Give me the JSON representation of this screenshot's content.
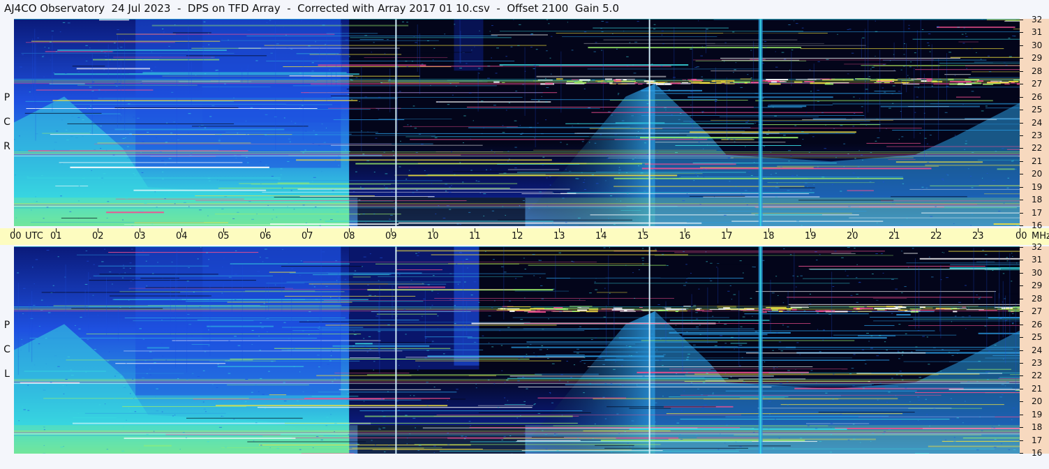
{
  "header": {
    "title": "AJ4CO Observatory  24 Jul 2023  -  DPS on TFD Array  -  Corrected with Array 2017 01 10.csv  -  Offset 2100  Gain 5.0"
  },
  "panels": [
    {
      "polarization": "RCP",
      "letters": [
        "R",
        "C",
        "P"
      ]
    },
    {
      "polarization": "LCP",
      "letters": [
        "L",
        "C",
        "P"
      ]
    }
  ],
  "chart_data": {
    "type": "heatmap",
    "title": "AJ4CO Observatory  24 Jul 2023  -  DPS on TFD Array  -  Corrected with Array 2017 01 10.csv  -  Offset 2100  Gain 5.0",
    "x_ticks": [
      "00",
      "01",
      "02",
      "03",
      "04",
      "05",
      "06",
      "07",
      "08",
      "09",
      "10",
      "11",
      "12",
      "13",
      "14",
      "15",
      "16",
      "17",
      "18",
      "19",
      "20",
      "21",
      "22",
      "23",
      "00"
    ],
    "x_units": "UTC",
    "y_ticks": [
      "32",
      "31",
      "30",
      "29",
      "28",
      "27",
      "26",
      "25",
      "24",
      "23",
      "22",
      "21",
      "20",
      "19",
      "18",
      "17",
      "16"
    ],
    "y_units": "MHz",
    "xlim": [
      0,
      24
    ],
    "ylim": [
      16,
      32
    ],
    "series": [
      {
        "name": "RCP"
      },
      {
        "name": "LCP"
      }
    ],
    "colormap": [
      "#03051a",
      "#0a1a7a",
      "#1e50e0",
      "#2a9ae0",
      "#38d8e0",
      "#9cf06a",
      "#f0e040",
      "#f05090",
      "#ffffff"
    ],
    "features": {
      "dark_window_utc": [
        8.0,
        12.0
      ],
      "vertical_lines_utc": [
        9.1,
        15.15,
        17.8
      ],
      "bright_bands_mhz": [
        27.2,
        21.6,
        17.6
      ]
    }
  }
}
